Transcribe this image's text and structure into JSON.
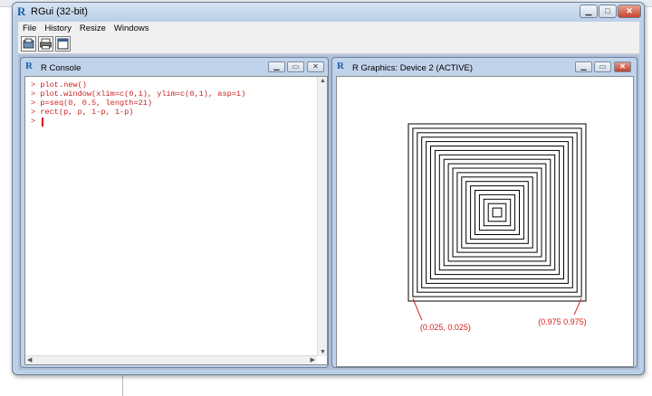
{
  "window": {
    "title": "RGui (32-bit)",
    "icon": "r-logo-icon"
  },
  "menu": [
    "File",
    "History",
    "Resize",
    "Windows"
  ],
  "toolbar": {
    "icons": [
      "open-script-icon",
      "print-icon",
      "window-icon"
    ]
  },
  "console": {
    "title": "R Console",
    "lines": [
      "> plot.new()",
      "> plot.window(xlim=c(0,1), ylim=c(0,1), asp=1)",
      "> p=seq(0, 0.5, length=21)",
      "> rect(p, p, 1-p, 1-p)",
      ">"
    ],
    "text_color": "#cc1f1f"
  },
  "graphics": {
    "title": "R Graphics: Device 2 (ACTIVE)",
    "annotation_bottom_left": "(0.025, 0.025)",
    "annotation_bottom_right": "(0.975 0.975)",
    "annotation_color": "#d42020"
  },
  "chart_data": {
    "type": "other",
    "description": "nested squares from rect(p, p, 1-p, 1-p)",
    "p": [
      0,
      0.025,
      0.05,
      0.075,
      0.1,
      0.125,
      0.15,
      0.175,
      0.2,
      0.225,
      0.25,
      0.275,
      0.3,
      0.325,
      0.35,
      0.375,
      0.4,
      0.425,
      0.45,
      0.475,
      0.5
    ],
    "xlim": [
      0,
      1
    ],
    "ylim": [
      0,
      1
    ]
  }
}
